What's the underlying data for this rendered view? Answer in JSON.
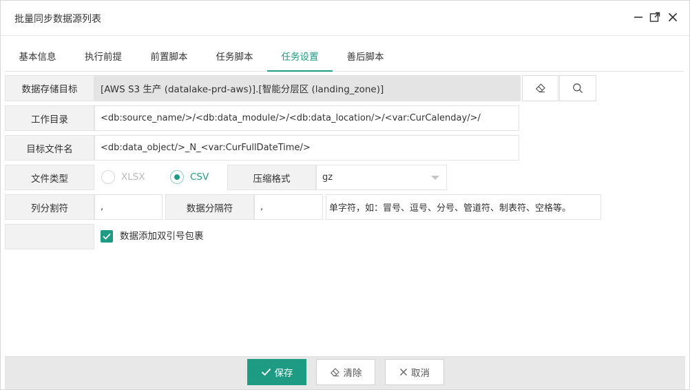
{
  "dialog": {
    "title": "批量同步数据源列表"
  },
  "tabs": [
    {
      "label": "基本信息"
    },
    {
      "label": "执行前提"
    },
    {
      "label": "前置脚本"
    },
    {
      "label": "任务脚本"
    },
    {
      "label": "任务设置",
      "active": true
    },
    {
      "label": "善后脚本"
    }
  ],
  "form": {
    "storage_target": {
      "label": "数据存储目标",
      "value": "[AWS S3 生产 (datalake-prd-aws)].[智能分层区 (landing_zone)]"
    },
    "work_dir": {
      "label": "工作目录",
      "value": "<db:source_name/>/<db:data_module/>/<db:data_location/>/<var:CurCalenday/>/"
    },
    "target_filename": {
      "label": "目标文件名",
      "value": "<db:data_object/>_N_<var:CurFullDateTime/>"
    },
    "file_type": {
      "label": "文件类型",
      "options": [
        "XLSX",
        "CSV"
      ],
      "selected": "CSV"
    },
    "compression": {
      "label": "压缩格式",
      "value": "gz"
    },
    "column_separator": {
      "label": "列分割符",
      "value": ","
    },
    "data_separator": {
      "label": "数据分隔符",
      "value": ",",
      "hint": "单字符，如：冒号、逗号、分号、管道符、制表符、空格等。"
    },
    "quote_wrap": {
      "label": "数据添加双引号包裹",
      "checked": true
    }
  },
  "footer": {
    "save_label": "保存",
    "clear_label": "清除",
    "cancel_label": "取消"
  },
  "colors": {
    "accent": "#1e9b83",
    "label_bg": "#f2f2f2",
    "readonly_bg": "#e4e4e4"
  }
}
